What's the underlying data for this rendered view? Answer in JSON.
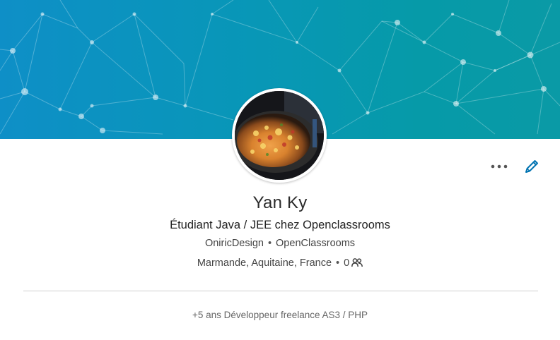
{
  "profile": {
    "name": "Yan Ky",
    "headline": "Étudiant Java / JEE chez Openclassrooms",
    "company_current": "OniricDesign",
    "company_school": "OpenClassrooms",
    "location": "Marmande, Aquitaine, France",
    "connections": "0",
    "summary": "+5 ans Développeur freelance AS3 / PHP",
    "separator": "•"
  },
  "icons": {
    "more": "more-icon",
    "edit": "pencil-icon",
    "connections": "people-icon"
  },
  "colors": {
    "banner_start": "#0e8fc7",
    "banner_end": "#0a9aa6",
    "accent": "#0073b1",
    "text": "#2b2b2b"
  }
}
